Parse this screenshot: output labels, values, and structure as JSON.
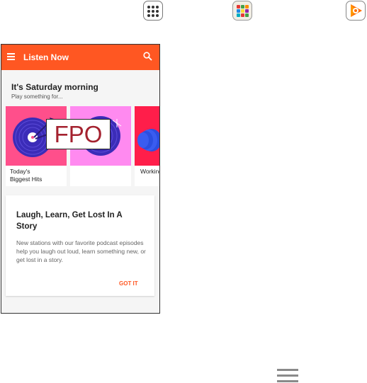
{
  "top_icons": [
    "apps-grid-icon",
    "app-folder-icon",
    "play-music-icon"
  ],
  "appbar": {
    "title": "Listen Now",
    "color": "#ff5722"
  },
  "section": {
    "title": "It's Saturday morning",
    "subtitle": "Play something for..."
  },
  "cards": [
    {
      "label": "Today's Biggest Hits",
      "line1": "Today's",
      "line2": "Biggest Hits"
    },
    {
      "label": ""
    },
    {
      "label": "Working"
    }
  ],
  "overlay": "FPO",
  "info_card": {
    "title": "Laugh, Learn, Get Lost In A Story",
    "body": "New stations with our favorite podcast episodes help you laugh out loud, learn something new, or get lost in a story.",
    "action": "GOT IT"
  },
  "nav_icon": "menu-icon"
}
